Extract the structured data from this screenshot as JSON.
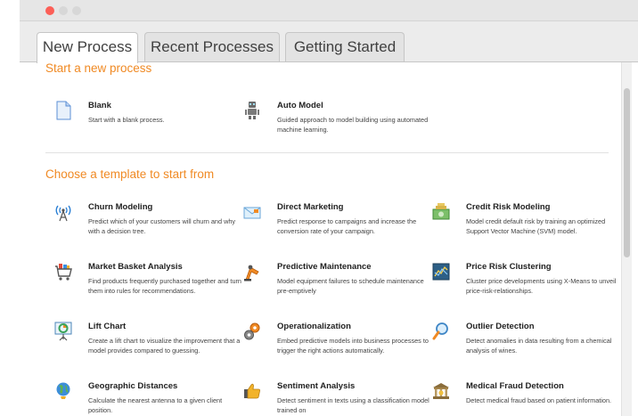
{
  "tabs": {
    "new_process": "New Process",
    "recent_processes": "Recent Processes",
    "getting_started": "Getting Started"
  },
  "section_new": {
    "title": "Start a new process",
    "items": [
      {
        "name": "Blank",
        "desc": "Start with a blank process.",
        "icon": "document-icon"
      },
      {
        "name": "Auto Model",
        "desc": "Guided approach to model building using automated machine learning.",
        "icon": "robot-icon"
      }
    ]
  },
  "section_templates": {
    "title": "Choose a template to start from",
    "items": [
      {
        "name": "Churn Modeling",
        "desc": "Predict which of your customers will churn and why with a decision tree.",
        "icon": "antenna-icon"
      },
      {
        "name": "Direct Marketing",
        "desc": "Predict response to campaigns and increase the conversion rate of your campaign.",
        "icon": "envelope-icon"
      },
      {
        "name": "Credit Risk Modeling",
        "desc": "Model credit default risk by training an optimized Support Vector Machine (SVM) model.",
        "icon": "money-icon"
      },
      {
        "name": "Market Basket Analysis",
        "desc": "Find products frequently purchased together and turn them into rules for recommendations.",
        "icon": "shopping-cart-icon"
      },
      {
        "name": "Predictive Maintenance",
        "desc": "Model equipment failures to schedule maintenance pre-emptively",
        "icon": "crane-icon"
      },
      {
        "name": "Price Risk Clustering",
        "desc": "Cluster price developments using X-Means to unveil price-risk-relationships.",
        "icon": "chart-icon"
      },
      {
        "name": "Lift Chart",
        "desc": "Create a lift chart to visualize the improvement that a model provides compared to guessing.",
        "icon": "presentation-icon"
      },
      {
        "name": "Operationalization",
        "desc": "Embed predictive models into business processes to trigger the right actions automatically.",
        "icon": "gears-icon"
      },
      {
        "name": "Outlier Detection",
        "desc": "Detect anomalies in data resulting from a chemical analysis of wines.",
        "icon": "magnifier-icon"
      },
      {
        "name": "Geographic Distances",
        "desc": "Calculate the nearest antenna to a given client position.",
        "icon": "globe-icon"
      },
      {
        "name": "Sentiment Analysis",
        "desc": "Detect sentiment in texts using a classification model trained on",
        "icon": "thumbs-up-icon"
      },
      {
        "name": "Medical Fraud Detection",
        "desc": "Detect medical fraud based on patient information.",
        "icon": "bank-icon"
      }
    ]
  },
  "colors": {
    "accent": "#f08a24",
    "window_close": "#fc5f57"
  }
}
